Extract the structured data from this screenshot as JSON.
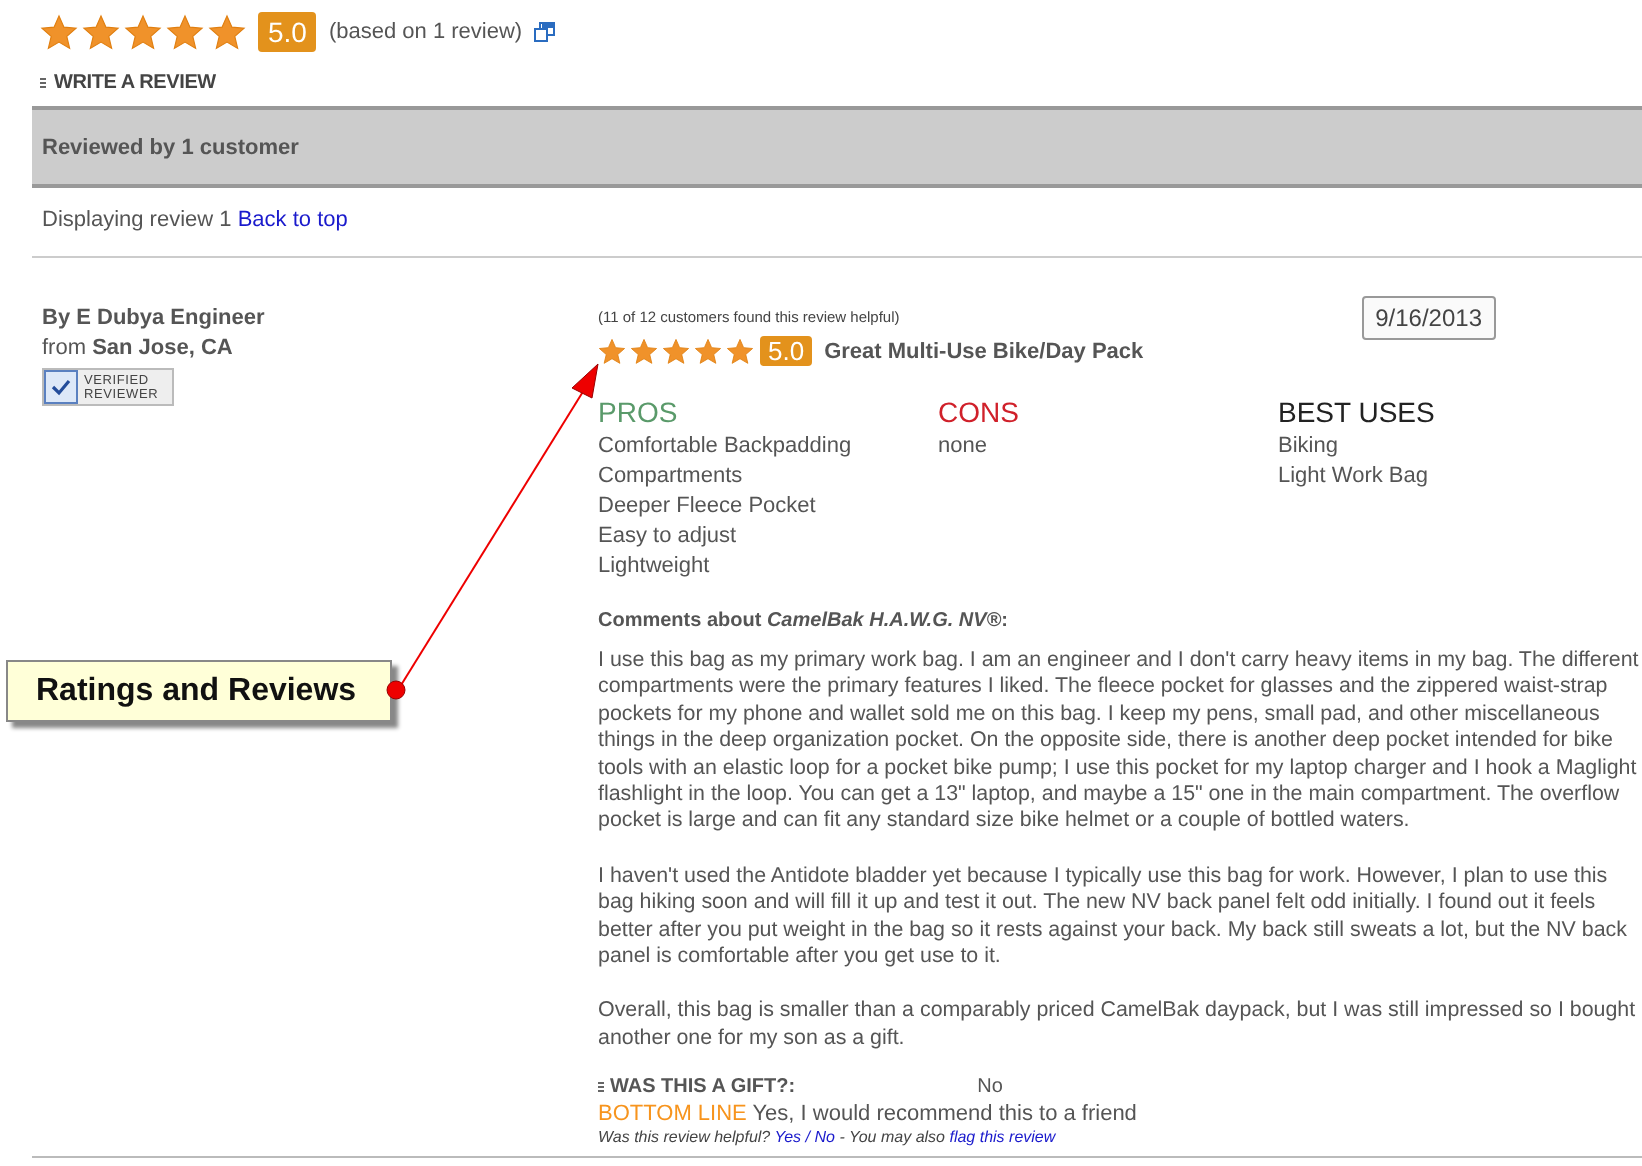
{
  "summary": {
    "stars": 5,
    "score": "5.0",
    "based_on": "(based on 1 review)",
    "write_review": "WRITE A REVIEW"
  },
  "band": {
    "title": "Reviewed by 1 customer"
  },
  "display": {
    "text": "Displaying review 1",
    "link": "Back to top"
  },
  "review": {
    "author": "By E Dubya Engineer",
    "location_label": "from",
    "location": "San Jose, CA",
    "badge": "VERIFIED REVIEWER",
    "helpful_count": "(11 of 12 customers found this review helpful)",
    "stars": 5,
    "score": "5.0",
    "title": "Great Multi-Use Bike/Day Pack",
    "date": "9/16/2013",
    "columns": [
      {
        "kind": "pros",
        "heading": "PROS",
        "items": [
          "Comfortable Backpadding",
          "Compartments",
          "Deeper Fleece Pocket",
          "Easy to adjust",
          "Lightweight"
        ]
      },
      {
        "kind": "cons",
        "heading": "CONS",
        "items": [
          "none"
        ]
      },
      {
        "kind": "uses",
        "heading": "BEST USES",
        "items": [
          "Biking",
          "Light Work Bag"
        ]
      }
    ],
    "comments_heading": "Comments about *CamelBak H.A.W.G. NV®*:",
    "paragraphs": [
      "I use this bag as my primary work bag. I am an engineer and I don't carry heavy items in my bag. The different compartments were the primary features I liked. The fleece pocket for glasses and the zippered waist-strap pockets for my phone and wallet sold me on this bag. I keep my pens, small pad, and other miscellaneous things in the deep organization pocket. On the opposite side, there is another deep pocket intended for bike tools with an elastic loop for a pocket bike pump; I use this pocket for my laptop charger and I hook a Maglight flashlight in the loop. You can get a 13\" laptop, and maybe a 15\" one in the main compartment. The overflow pocket is large and can fit any standard size bike helmet or a couple of bottled waters.",
      "I haven't used the Antidote bladder yet because I typically use this bag for work. However, I plan to use this bag hiking soon and will fill it up and test it out. The new NV back panel felt odd initially. I found out it feels better after you put weight in the bag so it rests against your back. My back still sweats a lot, but the NV back panel is comfortable after you get use to it.",
      "Overall, this bag is smaller than a comparably priced CamelBak daypack, but I was still impressed so I bought another one for my son as a gift."
    ],
    "gift_label": "WAS THIS A GIFT?:",
    "gift_value": "No",
    "bottom_line_label": "BOTTOM LINE",
    "bottom_line": "Yes, I would recommend this to a friend",
    "feedback_prompt": "Was this review helpful?",
    "feedback_yes": "Yes",
    "feedback_sep": "/",
    "feedback_no": "No",
    "feedback_middle": "- You may also",
    "feedback_flag": "flag this review"
  },
  "callout": {
    "text": "Ratings and Reviews"
  }
}
